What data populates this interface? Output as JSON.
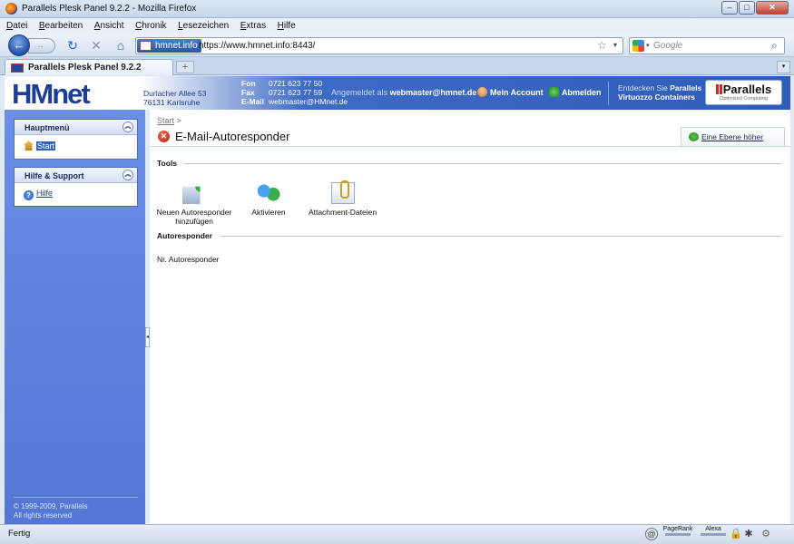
{
  "window": {
    "title": "Parallels Plesk Panel 9.2.2 - Mozilla Firefox",
    "minimize": "–",
    "maximize": "□",
    "close": "✕"
  },
  "menu": [
    "Datei",
    "Bearbeiten",
    "Ansicht",
    "Chronik",
    "Lesezeichen",
    "Extras",
    "Hilfe"
  ],
  "nav": {
    "back": "←",
    "forward": "→",
    "reload": "↻",
    "stop": "✕",
    "home": "⌂",
    "site_identity": "hmnet.info",
    "url": "https://www.hmnet.info:8443/",
    "star": "☆",
    "dropdown": "▾",
    "search_placeholder": "Google",
    "search_icon": "⌕"
  },
  "tabs": {
    "active_label": "Parallels Plesk Panel 9.2.2",
    "new_tab": "+",
    "list": "▾"
  },
  "header": {
    "logo": "HMnet",
    "address_line1": "Durlacher Allee 53",
    "address_line2": "76131 Karlsruhe",
    "contact_labels": [
      "Fon",
      "Fax",
      "E-Mail"
    ],
    "contact_values": [
      "0721 623 77 50",
      "0721 623 77 59",
      "webmaster@HMnet.de"
    ],
    "logged_in_prefix": "Angemeldet als",
    "logged_in_user": "webmaster@hmnet.de",
    "my_account": "Mein Account",
    "logout": "Abmelden",
    "promo_prefix": "Entdecken Sie",
    "promo_brand": "Parallels",
    "promo_product": "Virtuozzo Containers",
    "parallels_logo": "Parallels",
    "parallels_tagline": "Optimized Computing"
  },
  "sidebar": {
    "main_menu_title": "Hauptmenü",
    "start_label": "Start",
    "help_title": "Hilfe & Support",
    "help_label": "Hilfe",
    "collapse_glyph": "︽",
    "footer_line1": "© 1999-2009, Parallels",
    "footer_line2": "All rights reserved",
    "handle_glyph": "◂"
  },
  "main": {
    "breadcrumb_start": "Start",
    "breadcrumb_sep": " >",
    "title_icon": "✕",
    "title": "E-Mail-Autoresponder",
    "up_level": "Eine Ebene höher",
    "tools_heading": "Tools",
    "tools": [
      {
        "line1": "Neuen Autoresponder",
        "line2": "hinzufügen"
      },
      {
        "line1": "Aktivieren",
        "line2": ""
      },
      {
        "line1": "Attachment-Dateien",
        "line2": ""
      }
    ],
    "autoresponder_heading": "Autoresponder",
    "autoresponder_count": "Nr. Autoresponder"
  },
  "status": {
    "text": "Fertig",
    "at_icon": "@",
    "pagerank": "PageRank",
    "alexa": "Alexa",
    "lock": "🔒",
    "addon1": "✱",
    "addon2": "⚙"
  }
}
